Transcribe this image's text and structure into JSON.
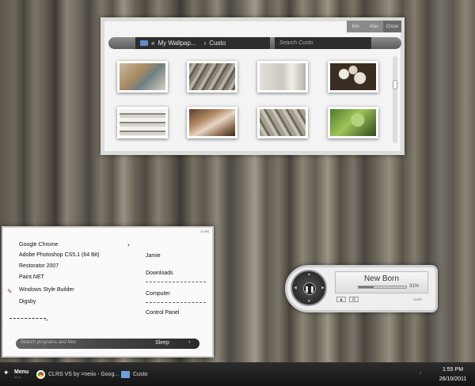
{
  "explorer": {
    "controls": [
      "Min",
      "Max",
      "Close"
    ],
    "path_arrows": "«",
    "path_parent": "My Wallpap...",
    "path_sep": "›",
    "path_current": "Custo",
    "search_placeholder": "Search Custo"
  },
  "start_menu": {
    "brand": "CLRS",
    "programs": [
      "Google Chrome",
      "Adobe Photoshop CS5.1 (64 Bit)",
      "Restorator 2007",
      "Paint.NET",
      "Windows Style Builder",
      "Digsby"
    ],
    "submenu_arrow": "›",
    "right_links": [
      "Jamie",
      "Downloads",
      "Computer",
      "Control Panel"
    ],
    "all_programs_arrow": "→",
    "search_placeholder": "Search programs and files",
    "sleep_label": "Sleep",
    "sleep_arrow": "›"
  },
  "player": {
    "title": "New Born",
    "progress_percent": 31,
    "progress_label": "31%",
    "pause_glyph": "❚❚",
    "brand": "CLRS"
  },
  "taskbar": {
    "menu_label": "Menu",
    "menu_sub": "clrs vs",
    "menu_logo": "✦",
    "tasks": [
      {
        "label": "CLRS VS by =neiio - Goog..."
      },
      {
        "label": "Custo"
      }
    ],
    "tray_arrow": "‹",
    "time": "1:55 PM",
    "date": "26/10/2011"
  }
}
